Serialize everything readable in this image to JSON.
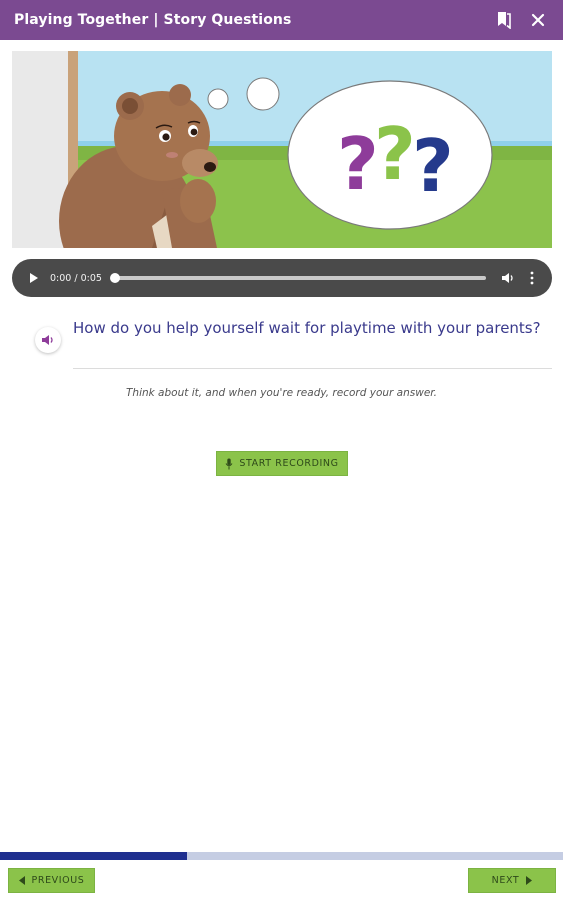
{
  "header": {
    "title": "Playing Together | Story Questions",
    "bookmark_icon": "bookmark-icon",
    "close_icon": "close-icon"
  },
  "scene": {
    "question_marks": [
      "?",
      "?",
      "?"
    ],
    "question_mark_colors": [
      "#8e3c9a",
      "#8bc34a",
      "#253a8c"
    ]
  },
  "audio": {
    "time": "0:00 / 0:05",
    "progress": 0
  },
  "question": {
    "text": "How do you help yourself wait for playtime with your parents?",
    "speaker_icon": "speaker-icon"
  },
  "instruction": "Think about it, and when you're ready, record your answer.",
  "record_button": {
    "label": "START RECORDING",
    "icon": "microphone-icon"
  },
  "progress": {
    "fraction": 0.333
  },
  "nav": {
    "previous_label": "PREVIOUS",
    "next_label": "NEXT"
  },
  "colors": {
    "header": "#7b4a91",
    "accent_green": "#8bc34a",
    "question_text": "#3a3a8c",
    "progress_fill": "#1f2f8f",
    "progress_track": "#c5cde3"
  }
}
